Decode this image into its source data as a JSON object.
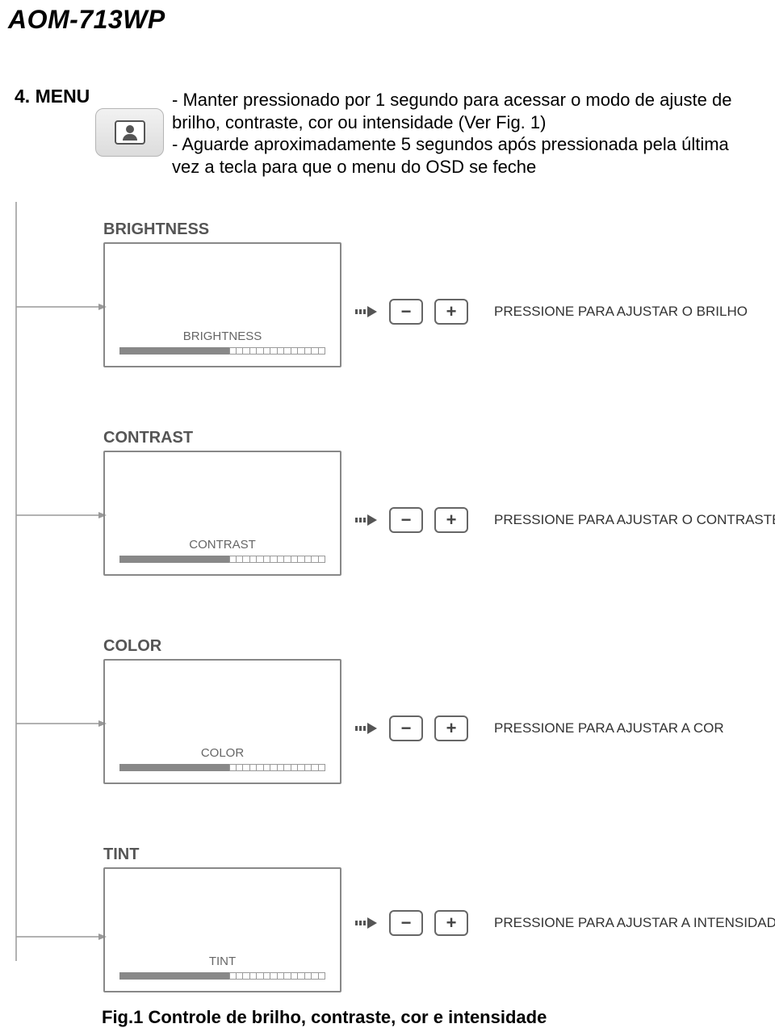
{
  "doc": {
    "title": "AOM-713WP",
    "menu_heading": "4. MENU",
    "menu_desc": "- Manter pressionado por 1 segundo para acessar o modo de ajuste de brilho, contraste, cor ou intensidade (Ver Fig. 1)\n- Aguarde aproximadamente 5 segundos após pressionada pela última vez a tecla para que o menu do OSD se feche",
    "fig_caption": "Fig.1 Controle de brilho, contraste, cor e intensidade"
  },
  "osd": {
    "brightness": {
      "title": "BRIGHTNESS",
      "inner": "BRIGHTNESS",
      "hint": "PRESSIONE PARA AJUSTAR O BRILHO"
    },
    "contrast": {
      "title": "CONTRAST",
      "inner": "CONTRAST",
      "hint": "PRESSIONE PARA AJUSTAR O CONTRASTE"
    },
    "color": {
      "title": "COLOR",
      "inner": "COLOR",
      "hint": "PRESSIONE PARA AJUSTAR A COR"
    },
    "tint": {
      "title": "TINT",
      "inner": "TINT",
      "hint": "PRESSIONE PARA AJUSTAR A INTENSIDADE"
    }
  },
  "buttons": {
    "minus": "−",
    "plus": "+"
  }
}
